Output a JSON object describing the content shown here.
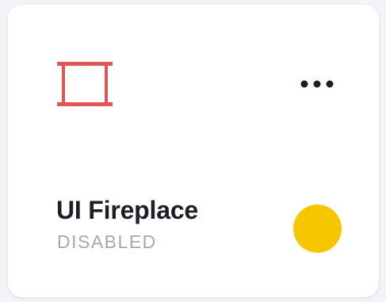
{
  "device": {
    "icon": "fireplace-icon",
    "name": "UI Fireplace",
    "status": "DISABLED",
    "menu_icon": "more-horizontal-icon"
  },
  "colors": {
    "icon": "#e05656",
    "toggle": "#f7c600",
    "title": "#1d1f27",
    "status": "#a5a8b4"
  }
}
